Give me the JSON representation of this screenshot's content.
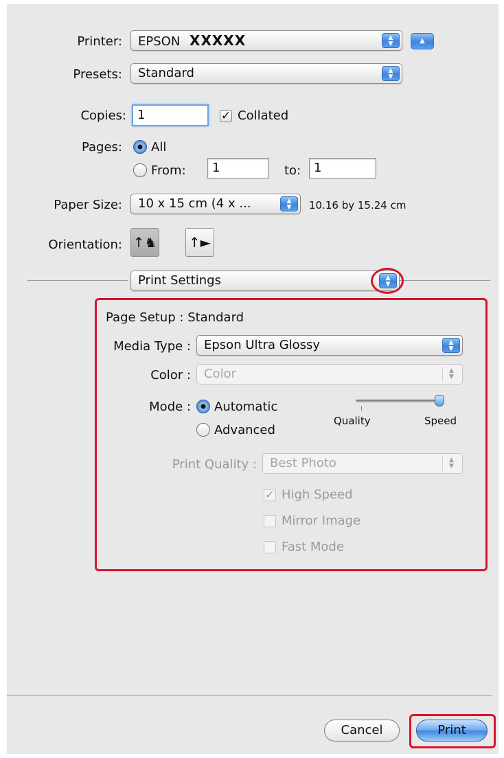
{
  "printer": {
    "label": "Printer:",
    "value_prefix": "EPSON",
    "value_model": "XXXXX"
  },
  "presets": {
    "label": "Presets:",
    "value": "Standard"
  },
  "copies": {
    "label": "Copies:",
    "value": "1",
    "collated_label": "Collated",
    "collated_checked": true
  },
  "pages": {
    "label": "Pages:",
    "all_label": "All",
    "from_label": "From:",
    "from_value": "1",
    "to_label": "to:",
    "to_value": "1",
    "selected": "All"
  },
  "paper_size": {
    "label": "Paper Size:",
    "value": "10 x 15 cm (4 x ...",
    "dimensions": "10.16 by 15.24 cm"
  },
  "orientation": {
    "label": "Orientation:",
    "options": [
      "portrait",
      "landscape"
    ],
    "selected": "portrait"
  },
  "panel_popup": {
    "value": "Print Settings"
  },
  "settings": {
    "page_setup": "Page Setup : Standard",
    "media_type": {
      "label": "Media Type :",
      "value": "Epson Ultra Glossy"
    },
    "color": {
      "label": "Color :",
      "value": "Color"
    },
    "mode": {
      "label": "Mode :",
      "automatic_label": "Automatic",
      "advanced_label": "Advanced",
      "selected": "Automatic"
    },
    "slider": {
      "left_label": "Quality",
      "right_label": "Speed",
      "value": 1.0
    },
    "print_quality": {
      "label": "Print Quality :",
      "value": "Best Photo"
    },
    "high_speed": {
      "label": "High Speed",
      "checked": true
    },
    "mirror_image": {
      "label": "Mirror Image",
      "checked": false
    },
    "fast_mode": {
      "label": "Fast Mode",
      "checked": false
    }
  },
  "buttons": {
    "cancel": "Cancel",
    "print": "Print"
  },
  "colors": {
    "highlight": "#d8152c",
    "accent": "#3d84dd",
    "panel_bg": "#e8e8e8"
  },
  "icons": {
    "popup_arrows": "up-down-arrows-icon",
    "disclosure": "triangle-up-icon"
  }
}
